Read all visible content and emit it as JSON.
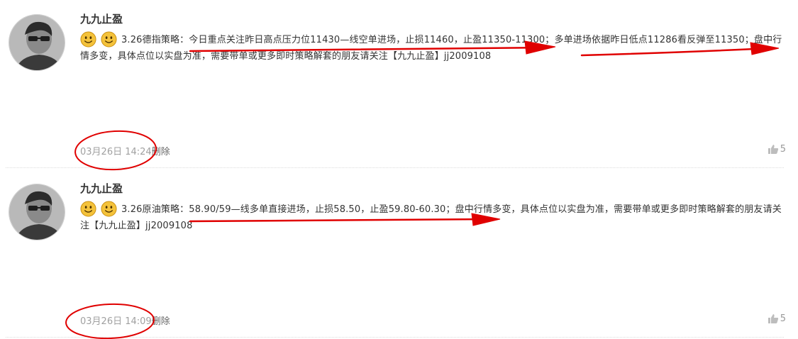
{
  "posts": [
    {
      "author": "九九止盈",
      "text": "3.26德指策略：今日重点关注昨日高点压力位11430—线空单进场，止损11460，止盈11350-11300；多单进场依据昨日低点11286看反弹至11350；盘中行情多变，具体点位以实盘为准，需要带单或更多即时策略解套的朋友请关注【九九止盈】jj2009108",
      "emojis": [
        "smile-emoji",
        "smile-emoji"
      ],
      "time": "03月26日 14:24",
      "delete_label": "删除",
      "likes": "5"
    },
    {
      "author": "九九止盈",
      "text": "3.26原油策略：58.90/59—线多单直接进场，止损58.50，止盈59.80-60.30；盘中行情多变，具体点位以实盘为准，需要带单或更多即时策略解套的朋友请关注【九九止盈】jj2009108",
      "emojis": [
        "smile-emoji",
        "smile-emoji"
      ],
      "time": "03月26日 14:09",
      "delete_label": "删除",
      "likes": "5"
    }
  ],
  "colors": {
    "annotation": "#e00000",
    "time": "#a0a0a0",
    "text": "#333333",
    "emoji": "#f4c23a"
  }
}
